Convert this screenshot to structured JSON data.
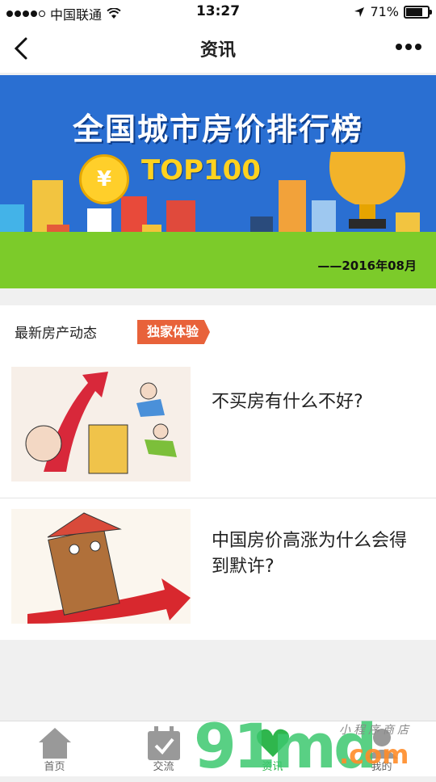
{
  "status_bar": {
    "carrier": "中国联通",
    "time": "13:27",
    "battery": "71%"
  },
  "nav": {
    "title": "资讯"
  },
  "banner": {
    "title": "全国城市房价排行榜",
    "subtitle": "TOP100",
    "coin_symbol": "¥",
    "date": "——2016年08月"
  },
  "section": {
    "heading": "最新房产动态",
    "tag": "独家体验"
  },
  "articles": [
    {
      "title": "不买房有什么不好?"
    },
    {
      "title": "中国房价高涨为什么会得到默许?"
    }
  ],
  "tabbar": {
    "items": [
      {
        "label": "首页",
        "icon": "home-icon"
      },
      {
        "label": "交流",
        "icon": "calendar-check-icon"
      },
      {
        "label": "资讯",
        "icon": "news-icon",
        "active": true
      },
      {
        "label": "我的",
        "icon": "user-icon"
      }
    ]
  },
  "watermark": {
    "text": "91md",
    "suffix": ".com",
    "caption": "小程序商店"
  },
  "colors": {
    "accent": "#2fb64d",
    "tag": "#e8623a",
    "banner_bg": "#2a6fd2"
  }
}
